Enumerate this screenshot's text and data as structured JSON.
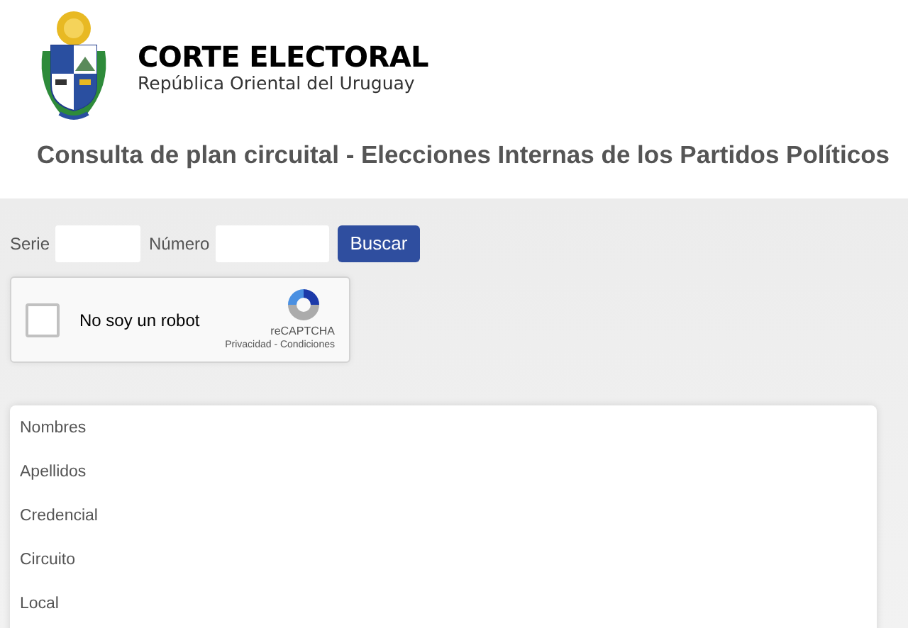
{
  "header": {
    "title": "CORTE ELECTORAL",
    "subtitle": "República Oriental del Uruguay"
  },
  "page_title": "Consulta de plan circuital - Elecciones Internas de los Partidos Políticos",
  "form": {
    "fields": [
      {
        "label": "Serie"
      },
      {
        "label": "Número"
      }
    ],
    "button": "Buscar"
  },
  "captcha": {
    "label": "No soy un robot",
    "checked": false,
    "brand": "reCAPTCHA",
    "links": "Privacidad - Condiciones"
  },
  "results": [
    {
      "label": "Nombres"
    },
    {
      "label": "Apellidos"
    },
    {
      "label": "Credencial"
    },
    {
      "label": "Circuito"
    },
    {
      "label": "Local"
    }
  ]
}
